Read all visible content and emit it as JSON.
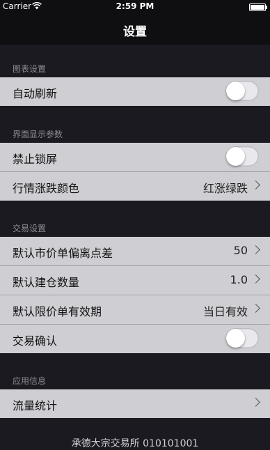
{
  "status_bar": {
    "carrier": "Carrier",
    "time": "2:59 PM"
  },
  "nav": {
    "title": "设置"
  },
  "sections": {
    "chart": {
      "header": "图表设置",
      "rows": {
        "auto_refresh": {
          "label": "自动刷新",
          "toggle": "off"
        }
      }
    },
    "display": {
      "header": "界面显示参数",
      "rows": {
        "no_lock": {
          "label": "禁止锁屏",
          "toggle": "off"
        },
        "color": {
          "label": "行情涨跌颜色",
          "value": "红涨绿跌"
        }
      }
    },
    "trade": {
      "header": "交易设置",
      "rows": {
        "spread": {
          "label": "默认市价单偏离点差",
          "value": "50"
        },
        "qty": {
          "label": "默认建仓数量",
          "value": "1.0"
        },
        "validity": {
          "label": "默认限价单有效期",
          "value": "当日有效"
        },
        "confirm": {
          "label": "交易确认",
          "toggle": "off"
        }
      }
    },
    "app": {
      "header": "应用信息",
      "rows": {
        "traffic": {
          "label": "流量统计"
        }
      }
    }
  },
  "footer": {
    "text": "承德大宗交易所  010101001"
  },
  "icons": {
    "wifi": "wifi-icon",
    "battery": "battery-icon",
    "chevron": "chevron-right-icon"
  },
  "colors": {
    "background": "#1b1a20",
    "row_background": "#cfced3",
    "header_text": "#8d8c95",
    "toggle_off": "#e9e8ec"
  }
}
